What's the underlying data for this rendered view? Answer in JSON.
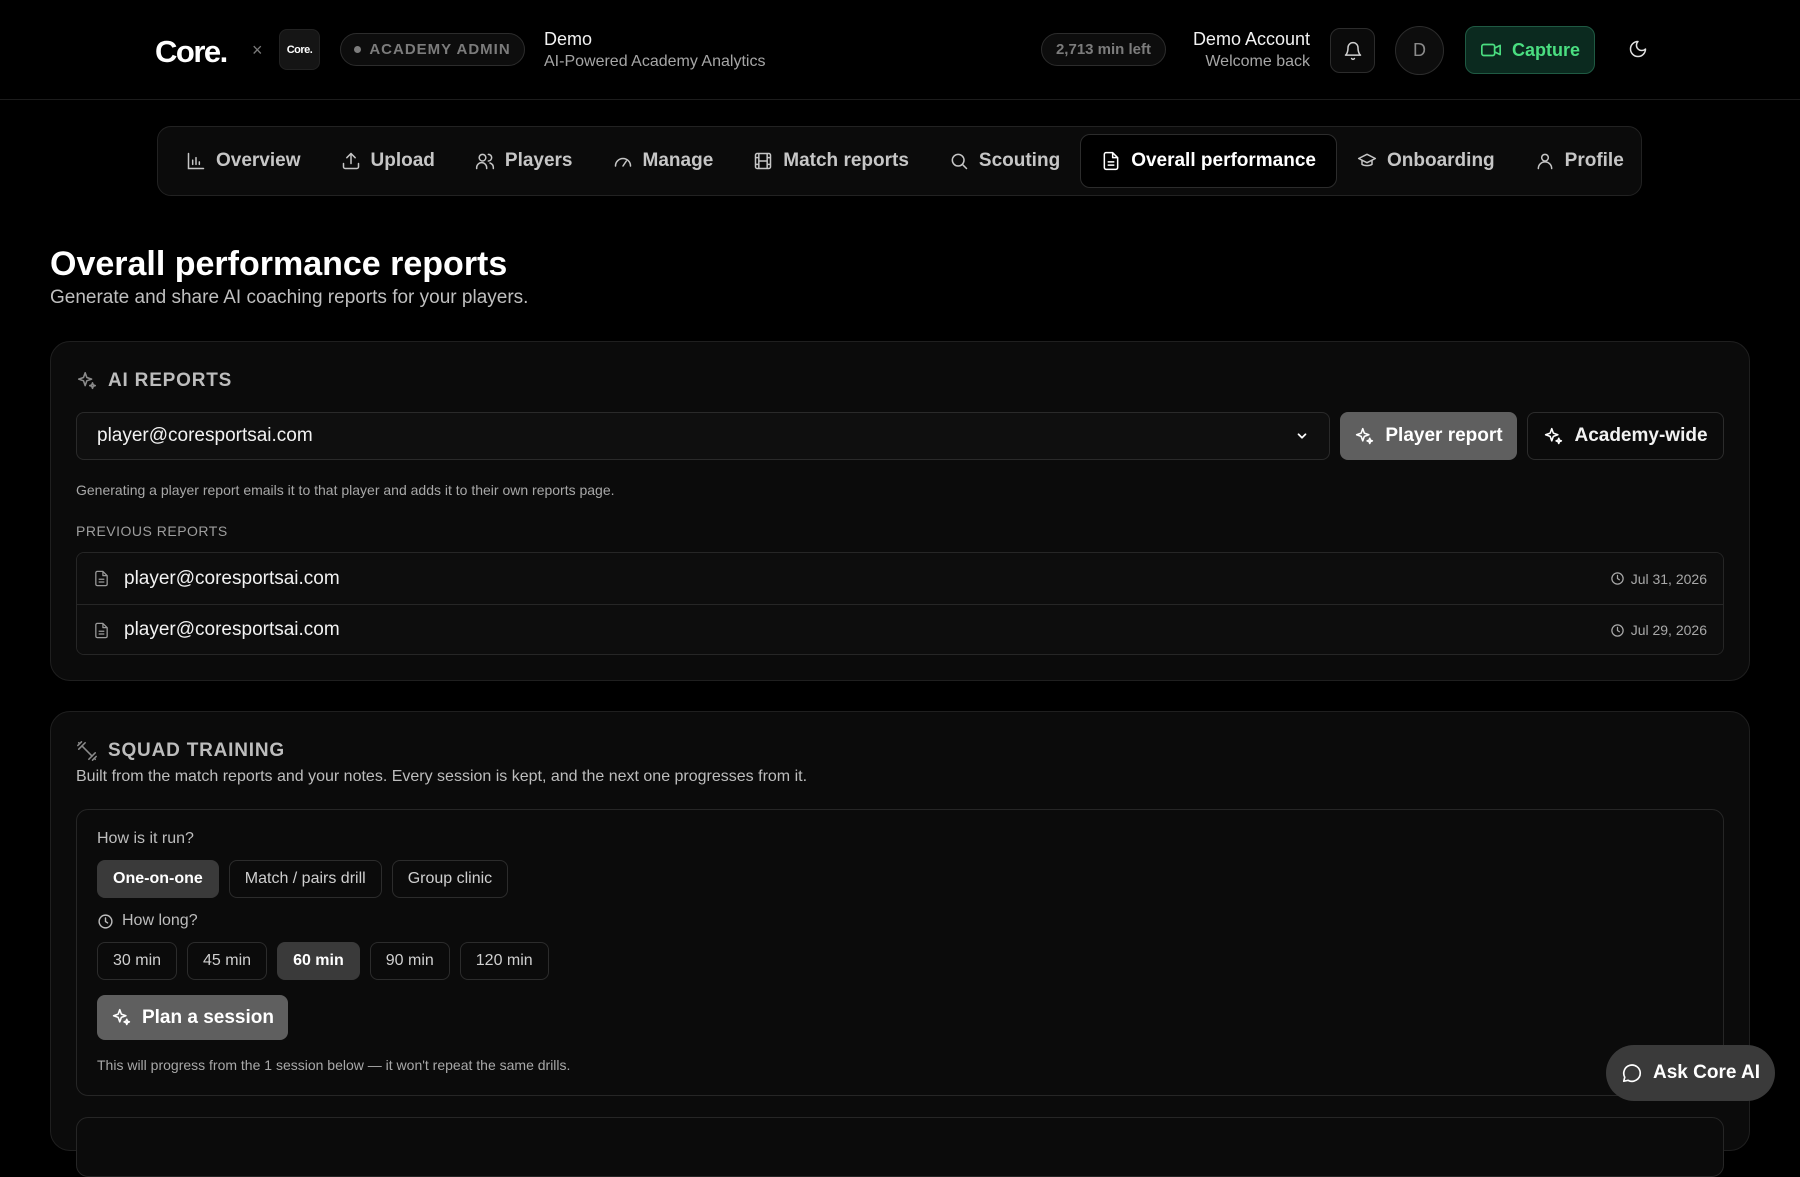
{
  "header": {
    "logo_text": "Core.",
    "logo_separator": "×",
    "partner_logo_text": "Core.",
    "role_badge": "ACADEMY ADMIN",
    "org_name": "Demo",
    "org_subtitle": "AI-Powered Academy Analytics",
    "credits": "2,713 min left",
    "account_name": "Demo Account",
    "account_subtitle": "Welcome back",
    "avatar_initial": "D",
    "capture_label": "Capture"
  },
  "nav": {
    "items": [
      {
        "label": "Overview",
        "icon": "bar-chart-icon"
      },
      {
        "label": "Upload",
        "icon": "upload-icon"
      },
      {
        "label": "Players",
        "icon": "users-icon"
      },
      {
        "label": "Manage",
        "icon": "gauge-icon"
      },
      {
        "label": "Match reports",
        "icon": "film-icon"
      },
      {
        "label": "Scouting",
        "icon": "search-icon"
      },
      {
        "label": "Overall performance",
        "icon": "document-icon",
        "active": true
      },
      {
        "label": "Onboarding",
        "icon": "graduation-cap-icon"
      },
      {
        "label": "Profile",
        "icon": "user-icon"
      }
    ]
  },
  "page": {
    "title": "Overall performance reports",
    "subtitle": "Generate and share AI coaching reports for your players."
  },
  "ai_reports": {
    "heading": "AI REPORTS",
    "selected_player": "player@coresportsai.com",
    "player_report_label": "Player report",
    "academy_wide_label": "Academy-wide",
    "hint": "Generating a player report emails it to that player and adds it to their own reports page.",
    "previous_label": "PREVIOUS REPORTS",
    "previous": [
      {
        "email": "player@coresportsai.com",
        "date": "Jul 31, 2026"
      },
      {
        "email": "player@coresportsai.com",
        "date": "Jul 29, 2026"
      }
    ]
  },
  "squad_training": {
    "heading": "SQUAD TRAINING",
    "description": "Built from the match reports and your notes. Every session is kept, and the next one progresses from it.",
    "format_question": "How is it run?",
    "formats": [
      "One-on-one",
      "Match / pairs drill",
      "Group clinic"
    ],
    "selected_format": "One-on-one",
    "duration_question": "How long?",
    "durations": [
      "30 min",
      "45 min",
      "60 min",
      "90 min",
      "120 min"
    ],
    "selected_duration": "60 min",
    "plan_label": "Plan a session",
    "progress_note": "This will progress from the 1 session below — it won't repeat the same drills."
  },
  "assistant": {
    "label": "Ask Core AI"
  },
  "colors": {
    "background": "#000000",
    "card": "#0b0b0b",
    "accent_green": "#4ade80",
    "button_grey": "#5f5f5f"
  }
}
